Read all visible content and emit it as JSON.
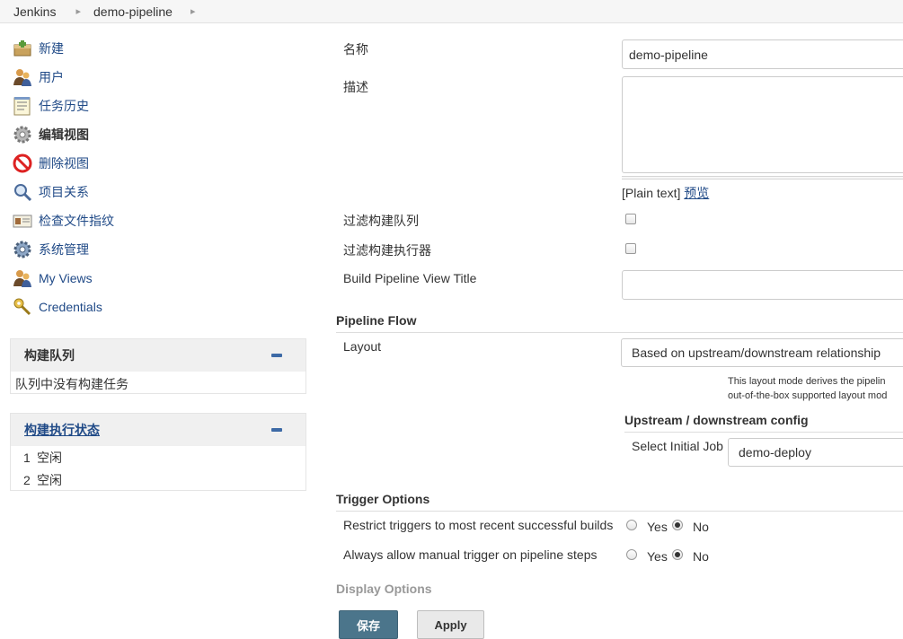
{
  "breadcrumb": {
    "root": "Jenkins",
    "current": "demo-pipeline"
  },
  "sidebar": {
    "items": [
      {
        "label": "新建",
        "icon": "new-item-icon"
      },
      {
        "label": "用户",
        "icon": "people-icon"
      },
      {
        "label": "任务历史",
        "icon": "notepad-icon"
      },
      {
        "label": "编辑视图",
        "icon": "gear-icon"
      },
      {
        "label": "删除视图",
        "icon": "no-entry-icon"
      },
      {
        "label": "项目关系",
        "icon": "search-icon"
      },
      {
        "label": "检查文件指纹",
        "icon": "fingerprint-icon"
      },
      {
        "label": "系统管理",
        "icon": "gear-icon"
      },
      {
        "label": "My Views",
        "icon": "people-icon"
      },
      {
        "label": "Credentials",
        "icon": "key-icon"
      }
    ]
  },
  "build_queue": {
    "title": "构建队列",
    "empty": "队列中没有构建任务"
  },
  "executors": {
    "title": "构建执行状态",
    "rows": [
      {
        "num": "1",
        "status": "空闲"
      },
      {
        "num": "2",
        "status": "空闲"
      }
    ]
  },
  "form": {
    "name_label": "名称",
    "name_value": "demo-pipeline",
    "desc_label": "描述",
    "desc_hint_prefix": "[Plain text]",
    "desc_preview": "预览",
    "filter_queue_label": "过滤构建队列",
    "filter_executors_label": "过滤构建执行器",
    "bp_title_label": "Build Pipeline View Title",
    "bp_title_value": ""
  },
  "pipeline_flow": {
    "title": "Pipeline Flow",
    "layout_label": "Layout",
    "layout_value": "Based on upstream/downstream relationship",
    "help_line1": "This layout mode derives the pipelin",
    "help_line2": "out-of-the-box supported layout mod",
    "upstream_title": "Upstream / downstream config",
    "initial_job_label": "Select Initial Job",
    "initial_job_value": "demo-deploy"
  },
  "trigger_options": {
    "title": "Trigger Options",
    "restrict_label": "Restrict triggers to most recent successful builds",
    "manual_label": "Always allow manual trigger on pipeline steps",
    "yes": "Yes",
    "no": "No",
    "restrict_selected": "No",
    "manual_selected": "No"
  },
  "display_options": {
    "title": "Display Options"
  },
  "buttons": {
    "save": "保存",
    "apply": "Apply"
  }
}
